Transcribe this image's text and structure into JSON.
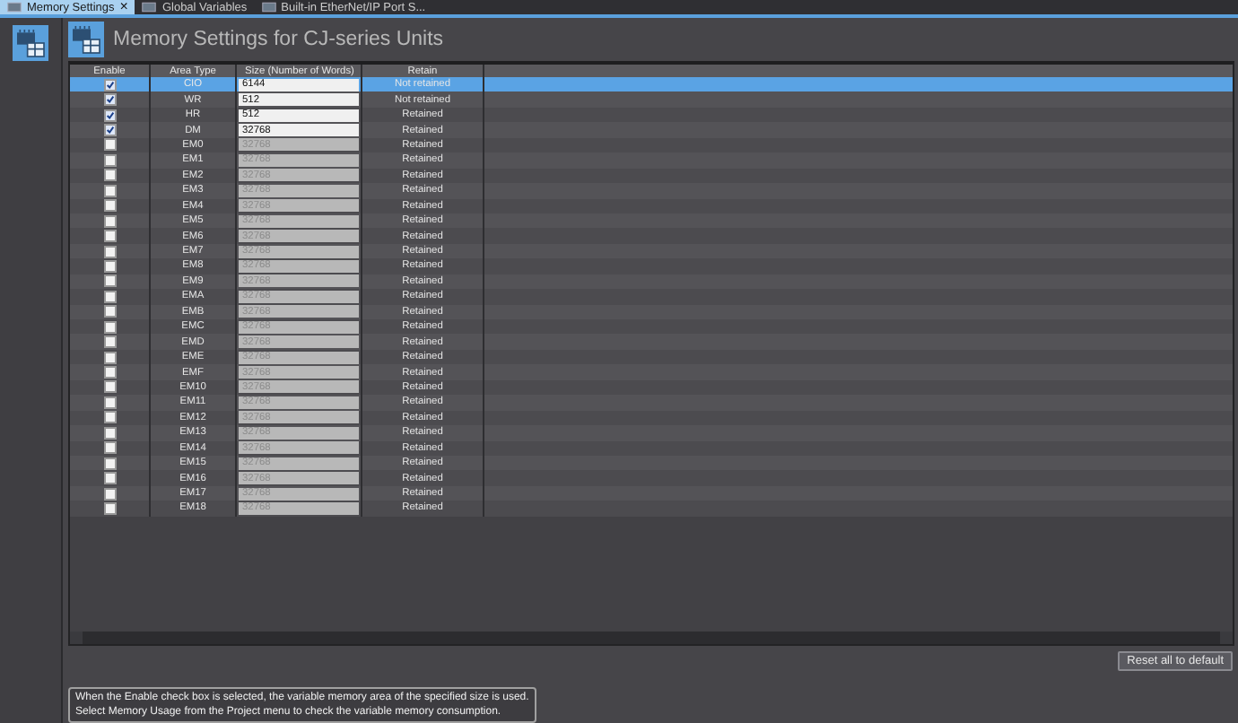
{
  "tabs": [
    {
      "label": "Memory Settings",
      "selected": true,
      "close": "×"
    },
    {
      "label": "Global Variables",
      "selected": false
    },
    {
      "label": "Built-in EtherNet/IP Port S...",
      "selected": false
    }
  ],
  "title": "Memory Settings for CJ-series Units",
  "table": {
    "columns": [
      "Enable",
      "Area Type",
      "Size (Number of Words)",
      "Retain"
    ],
    "rows": [
      {
        "checked": true,
        "area": "CIO",
        "size": "6144",
        "retain": "Not retained",
        "selected": true
      },
      {
        "checked": true,
        "area": "WR",
        "size": "512",
        "retain": "Not retained",
        "selected": false
      },
      {
        "checked": true,
        "area": "HR",
        "size": "512",
        "retain": "Retained",
        "selected": false
      },
      {
        "checked": true,
        "area": "DM",
        "size": "32768",
        "retain": "Retained",
        "selected": false
      },
      {
        "checked": false,
        "area": "EM0",
        "size": "32768",
        "retain": "Retained",
        "selected": false
      },
      {
        "checked": false,
        "area": "EM1",
        "size": "32768",
        "retain": "Retained",
        "selected": false
      },
      {
        "checked": false,
        "area": "EM2",
        "size": "32768",
        "retain": "Retained",
        "selected": false
      },
      {
        "checked": false,
        "area": "EM3",
        "size": "32768",
        "retain": "Retained",
        "selected": false
      },
      {
        "checked": false,
        "area": "EM4",
        "size": "32768",
        "retain": "Retained",
        "selected": false
      },
      {
        "checked": false,
        "area": "EM5",
        "size": "32768",
        "retain": "Retained",
        "selected": false
      },
      {
        "checked": false,
        "area": "EM6",
        "size": "32768",
        "retain": "Retained",
        "selected": false
      },
      {
        "checked": false,
        "area": "EM7",
        "size": "32768",
        "retain": "Retained",
        "selected": false
      },
      {
        "checked": false,
        "area": "EM8",
        "size": "32768",
        "retain": "Retained",
        "selected": false
      },
      {
        "checked": false,
        "area": "EM9",
        "size": "32768",
        "retain": "Retained",
        "selected": false
      },
      {
        "checked": false,
        "area": "EMA",
        "size": "32768",
        "retain": "Retained",
        "selected": false
      },
      {
        "checked": false,
        "area": "EMB",
        "size": "32768",
        "retain": "Retained",
        "selected": false
      },
      {
        "checked": false,
        "area": "EMC",
        "size": "32768",
        "retain": "Retained",
        "selected": false
      },
      {
        "checked": false,
        "area": "EMD",
        "size": "32768",
        "retain": "Retained",
        "selected": false
      },
      {
        "checked": false,
        "area": "EME",
        "size": "32768",
        "retain": "Retained",
        "selected": false
      },
      {
        "checked": false,
        "area": "EMF",
        "size": "32768",
        "retain": "Retained",
        "selected": false
      },
      {
        "checked": false,
        "area": "EM10",
        "size": "32768",
        "retain": "Retained",
        "selected": false
      },
      {
        "checked": false,
        "area": "EM11",
        "size": "32768",
        "retain": "Retained",
        "selected": false
      },
      {
        "checked": false,
        "area": "EM12",
        "size": "32768",
        "retain": "Retained",
        "selected": false
      },
      {
        "checked": false,
        "area": "EM13",
        "size": "32768",
        "retain": "Retained",
        "selected": false
      },
      {
        "checked": false,
        "area": "EM14",
        "size": "32768",
        "retain": "Retained",
        "selected": false
      },
      {
        "checked": false,
        "area": "EM15",
        "size": "32768",
        "retain": "Retained",
        "selected": false
      },
      {
        "checked": false,
        "area": "EM16",
        "size": "32768",
        "retain": "Retained",
        "selected": false
      },
      {
        "checked": false,
        "area": "EM17",
        "size": "32768",
        "retain": "Retained",
        "selected": false
      },
      {
        "checked": false,
        "area": "EM18",
        "size": "32768",
        "retain": "Retained",
        "selected": false
      }
    ]
  },
  "reset_button": "Reset all to default",
  "note": [
    "When the Enable check box is selected, the variable memory area of the specified size is used.",
    "Select Memory Usage from the Project menu to check the variable memory consumption."
  ]
}
